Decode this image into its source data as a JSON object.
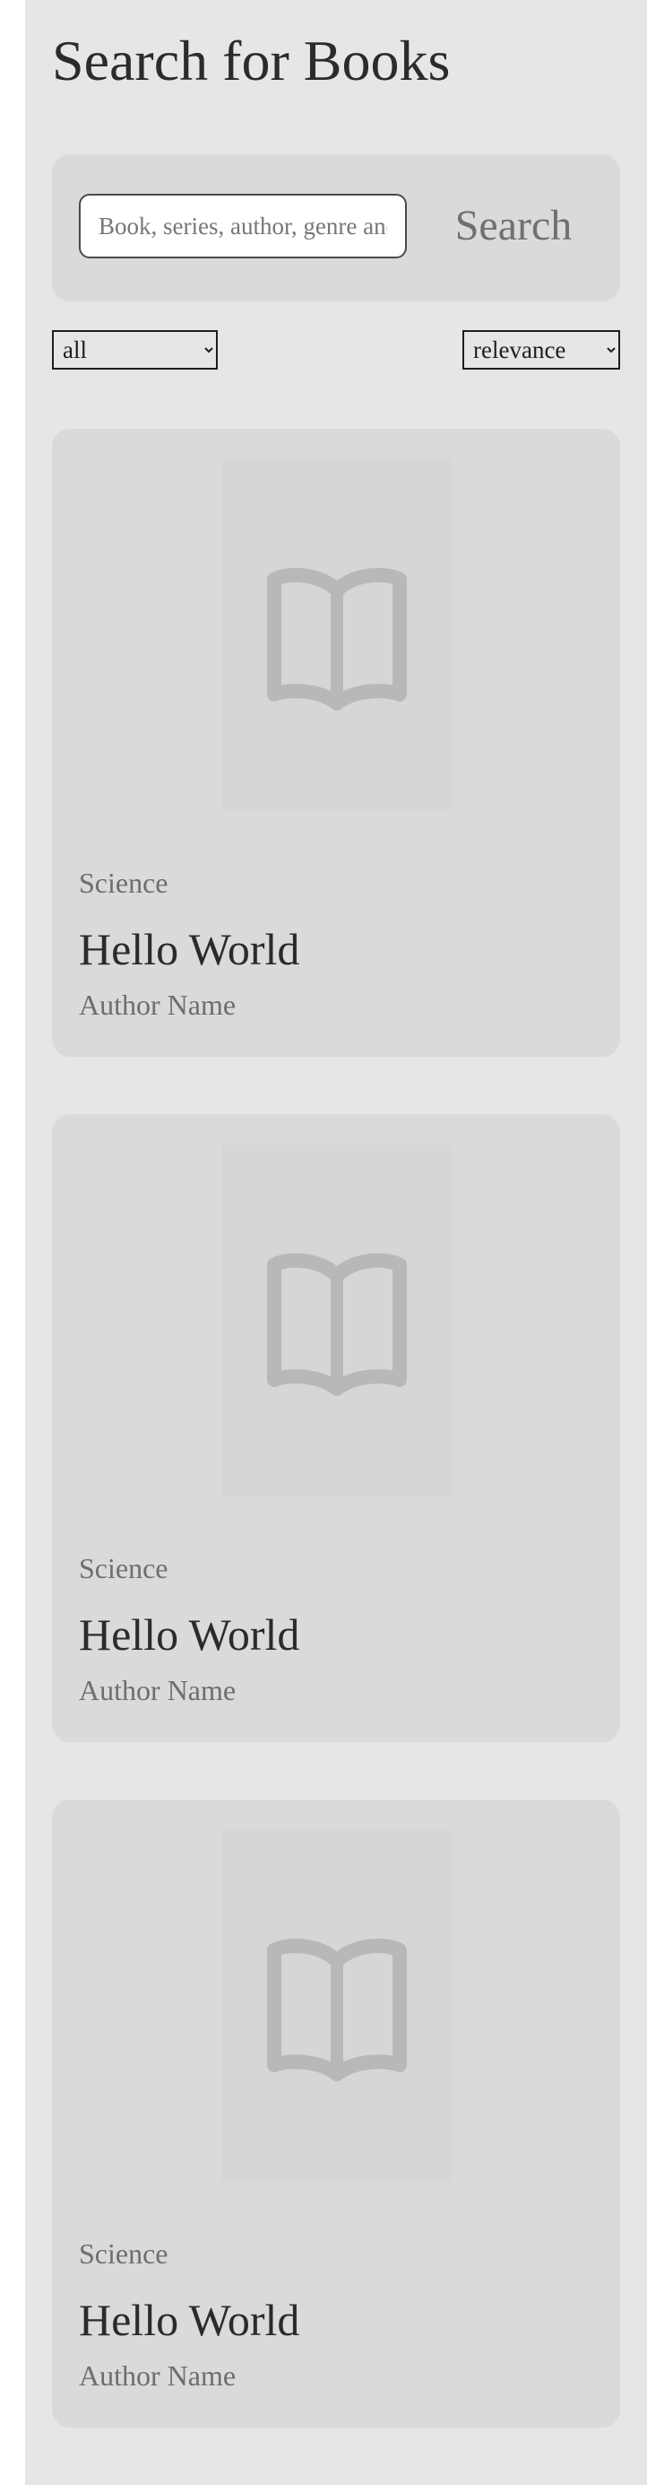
{
  "page": {
    "title": "Search for Books"
  },
  "search": {
    "placeholder": "Book, series, author, genre and more",
    "value": "",
    "button_label": "Search"
  },
  "filters": {
    "category": {
      "selected": "all",
      "options": [
        "all"
      ]
    },
    "sort": {
      "selected": "relevance",
      "options": [
        "relevance"
      ]
    }
  },
  "results": [
    {
      "genre": "Science",
      "title": "Hello World",
      "author": "Author Name",
      "cover_icon": "book-open-icon"
    },
    {
      "genre": "Science",
      "title": "Hello World",
      "author": "Author Name",
      "cover_icon": "book-open-icon"
    },
    {
      "genre": "Science",
      "title": "Hello World",
      "author": "Author Name",
      "cover_icon": "book-open-icon"
    }
  ],
  "colors": {
    "page_background": "#e6e6e8",
    "panel_background": "#dadadc",
    "icon": "#b8b8ba",
    "muted_text": "#6e6e6e",
    "text": "#2b2b2b"
  }
}
